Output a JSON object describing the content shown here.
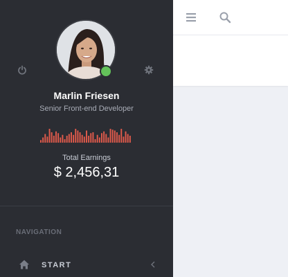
{
  "profile": {
    "name": "Marlin Friesen",
    "role": "Senior Front-end Developer",
    "status": "online"
  },
  "earnings": {
    "label": "Total Earnings",
    "value": "$ 2,456,31",
    "sparkline": [
      3,
      6,
      10,
      7,
      16,
      12,
      8,
      13,
      11,
      6,
      9,
      4,
      8,
      10,
      12,
      9,
      16,
      14,
      12,
      9,
      7,
      14,
      8,
      11,
      12,
      4,
      9,
      6,
      11,
      13,
      10,
      6,
      16,
      15,
      14,
      12,
      9,
      16,
      7,
      13,
      10,
      8
    ]
  },
  "navigation": {
    "heading": "NAVIGATION",
    "items": [
      {
        "label": "START",
        "icon": "home-icon"
      }
    ]
  },
  "topbar": {
    "icons": [
      "menu-icon",
      "search-icon"
    ]
  },
  "colors": {
    "sidebar": "#2b2d33",
    "accent_bars": "#e05a4b",
    "online": "#64c25a",
    "main_bg": "#eef0f5"
  }
}
